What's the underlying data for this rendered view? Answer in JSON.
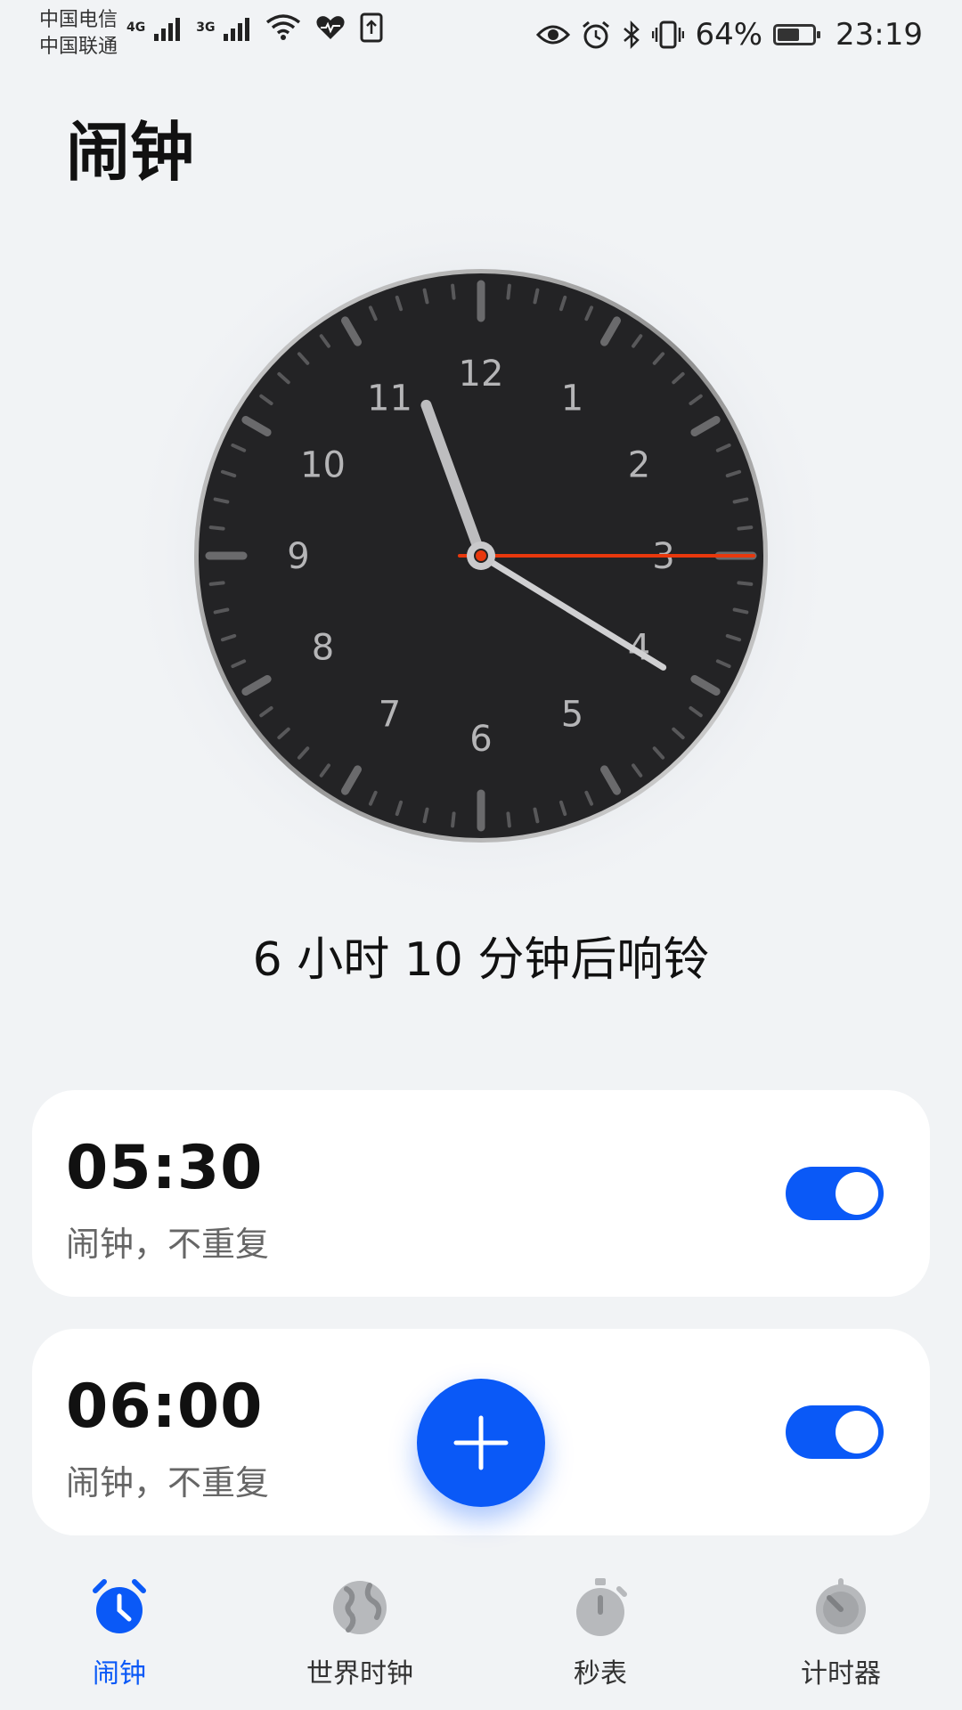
{
  "status_bar": {
    "carrier1": "中国电信",
    "carrier2": "中国联通",
    "net1": "4G",
    "net2": "3G",
    "battery": "64%",
    "battery_level": 0.64,
    "time": "23:19"
  },
  "title": "闹钟",
  "clock": {
    "hour": 11,
    "minute": 20,
    "second": 15,
    "numbers": [
      "12",
      "1",
      "2",
      "3",
      "4",
      "5",
      "6",
      "7",
      "8",
      "9",
      "10",
      "11"
    ],
    "face_color": "#232325",
    "second_hand_color": "#e8380d"
  },
  "countdown": "6 小时 10 分钟后响铃",
  "alarms": [
    {
      "time": "05:30",
      "subtitle": "闹钟，不重复",
      "enabled": true
    },
    {
      "time": "06:00",
      "subtitle": "闹钟，不重复",
      "enabled": true
    }
  ],
  "nav": {
    "items": [
      {
        "label": "闹钟",
        "icon": "alarm-clock-icon",
        "active": true
      },
      {
        "label": "世界时钟",
        "icon": "globe-icon",
        "active": false
      },
      {
        "label": "秒表",
        "icon": "stopwatch-icon",
        "active": false
      },
      {
        "label": "计时器",
        "icon": "timer-icon",
        "active": false
      }
    ]
  },
  "colors": {
    "accent": "#0a59f7",
    "background": "#f1f3f5"
  }
}
